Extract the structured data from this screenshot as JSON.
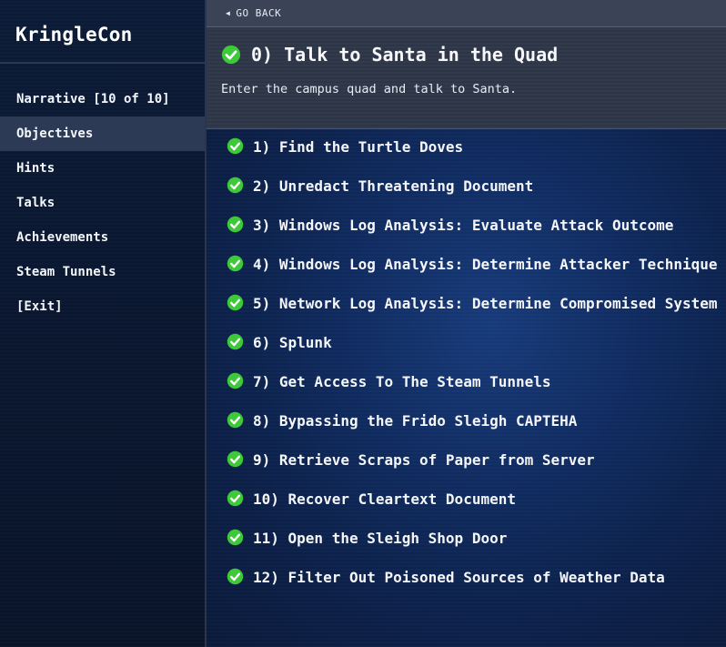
{
  "sidebar": {
    "brand": "KringleCon",
    "items": [
      {
        "label": "Narrative [10 of 10]"
      },
      {
        "label": "Objectives"
      },
      {
        "label": "Hints"
      },
      {
        "label": "Talks"
      },
      {
        "label": "Achievements"
      },
      {
        "label": "Steam Tunnels"
      },
      {
        "label": "[Exit]"
      }
    ],
    "active_item": "Objectives"
  },
  "main": {
    "go_back_label": "GO BACK",
    "selected": {
      "title": "0) Talk to Santa in the Quad",
      "description": "Enter the campus quad and talk to Santa.",
      "completed": true
    },
    "objectives": [
      {
        "label": "1) Find the Turtle Doves",
        "completed": true
      },
      {
        "label": "2) Unredact Threatening Document",
        "completed": true
      },
      {
        "label": "3) Windows Log Analysis: Evaluate Attack Outcome",
        "completed": true
      },
      {
        "label": "4) Windows Log Analysis: Determine Attacker Technique",
        "completed": true
      },
      {
        "label": "5) Network Log Analysis: Determine Compromised System",
        "completed": true
      },
      {
        "label": "6) Splunk",
        "completed": true
      },
      {
        "label": "7) Get Access To The Steam Tunnels",
        "completed": true
      },
      {
        "label": "8) Bypassing the Frido Sleigh CAPTEHA",
        "completed": true
      },
      {
        "label": "9) Retrieve Scraps of Paper from Server",
        "completed": true
      },
      {
        "label": "10) Recover Cleartext Document",
        "completed": true
      },
      {
        "label": "11) Open the Sleigh Shop Door",
        "completed": true
      },
      {
        "label": "12) Filter Out Poisoned Sources of Weather Data",
        "completed": true
      }
    ]
  },
  "icons": {
    "completed": "check-circle-icon",
    "go_back": "left-triangle-icon"
  },
  "colors": {
    "check_green": "#3ec93a",
    "sidebar_active": "#2c3a55",
    "main_bg": "#0f2b60"
  }
}
